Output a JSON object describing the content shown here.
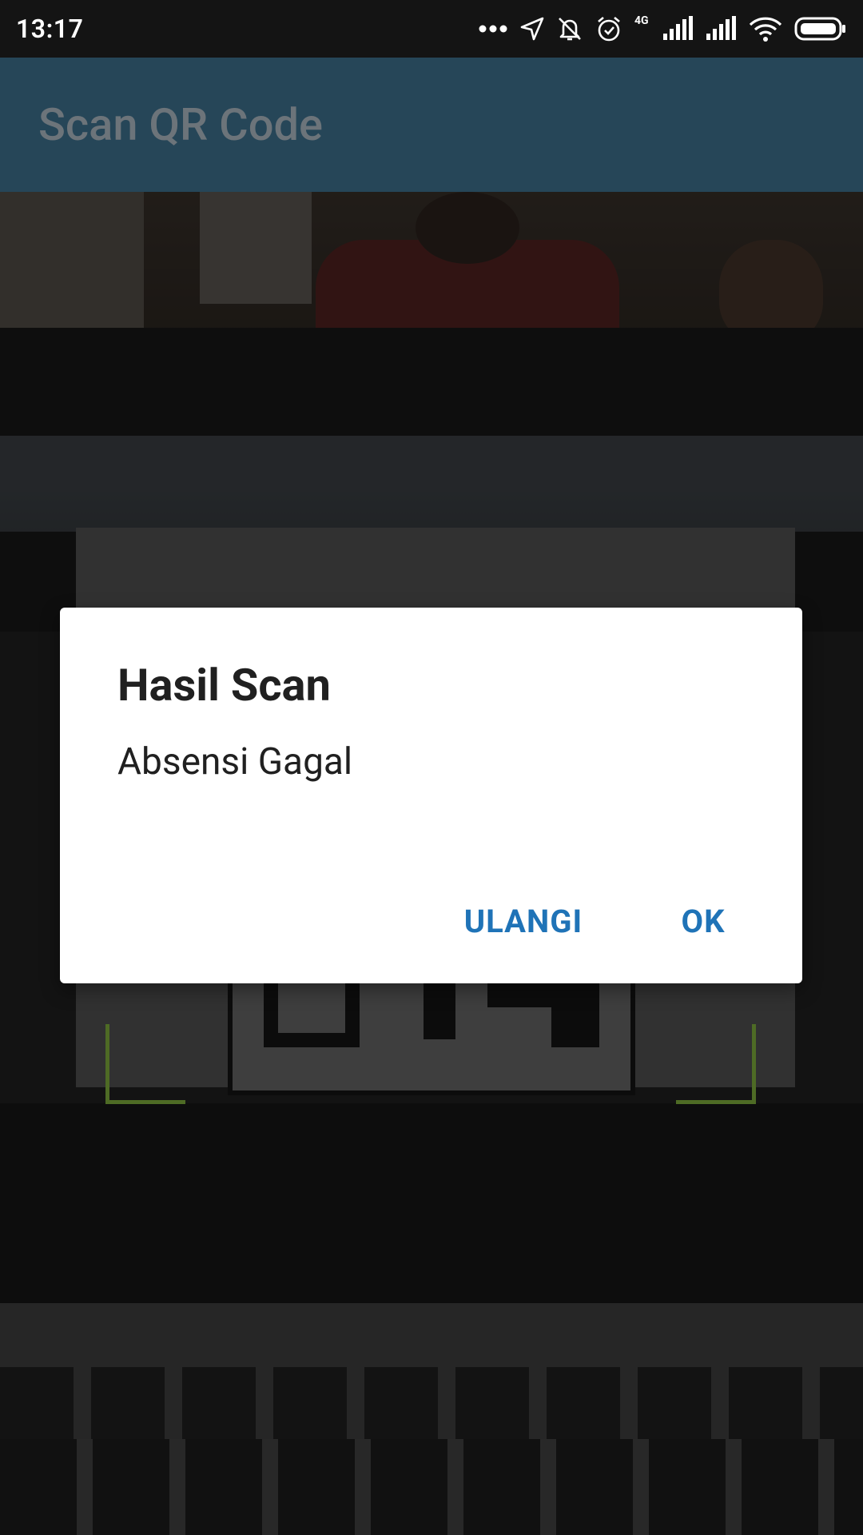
{
  "status_bar": {
    "time": "13:17",
    "network_type": "4G",
    "icons": [
      "more-dots-icon",
      "location-arrow-icon",
      "bell-off-icon",
      "alarm-icon",
      "signal-icon",
      "signal-icon",
      "wifi-icon",
      "battery-icon"
    ]
  },
  "app_bar": {
    "title": "Scan QR Code"
  },
  "dialog": {
    "title": "Hasil Scan",
    "message": "Absensi Gagal",
    "buttons": {
      "retry": "ULANGI",
      "ok": "OK"
    }
  },
  "colors": {
    "app_bar": "#264658",
    "app_title": "#6c747a",
    "accent": "#1f73b7",
    "scanner_corner": "#4e6b25",
    "status_bar": "#141414"
  }
}
